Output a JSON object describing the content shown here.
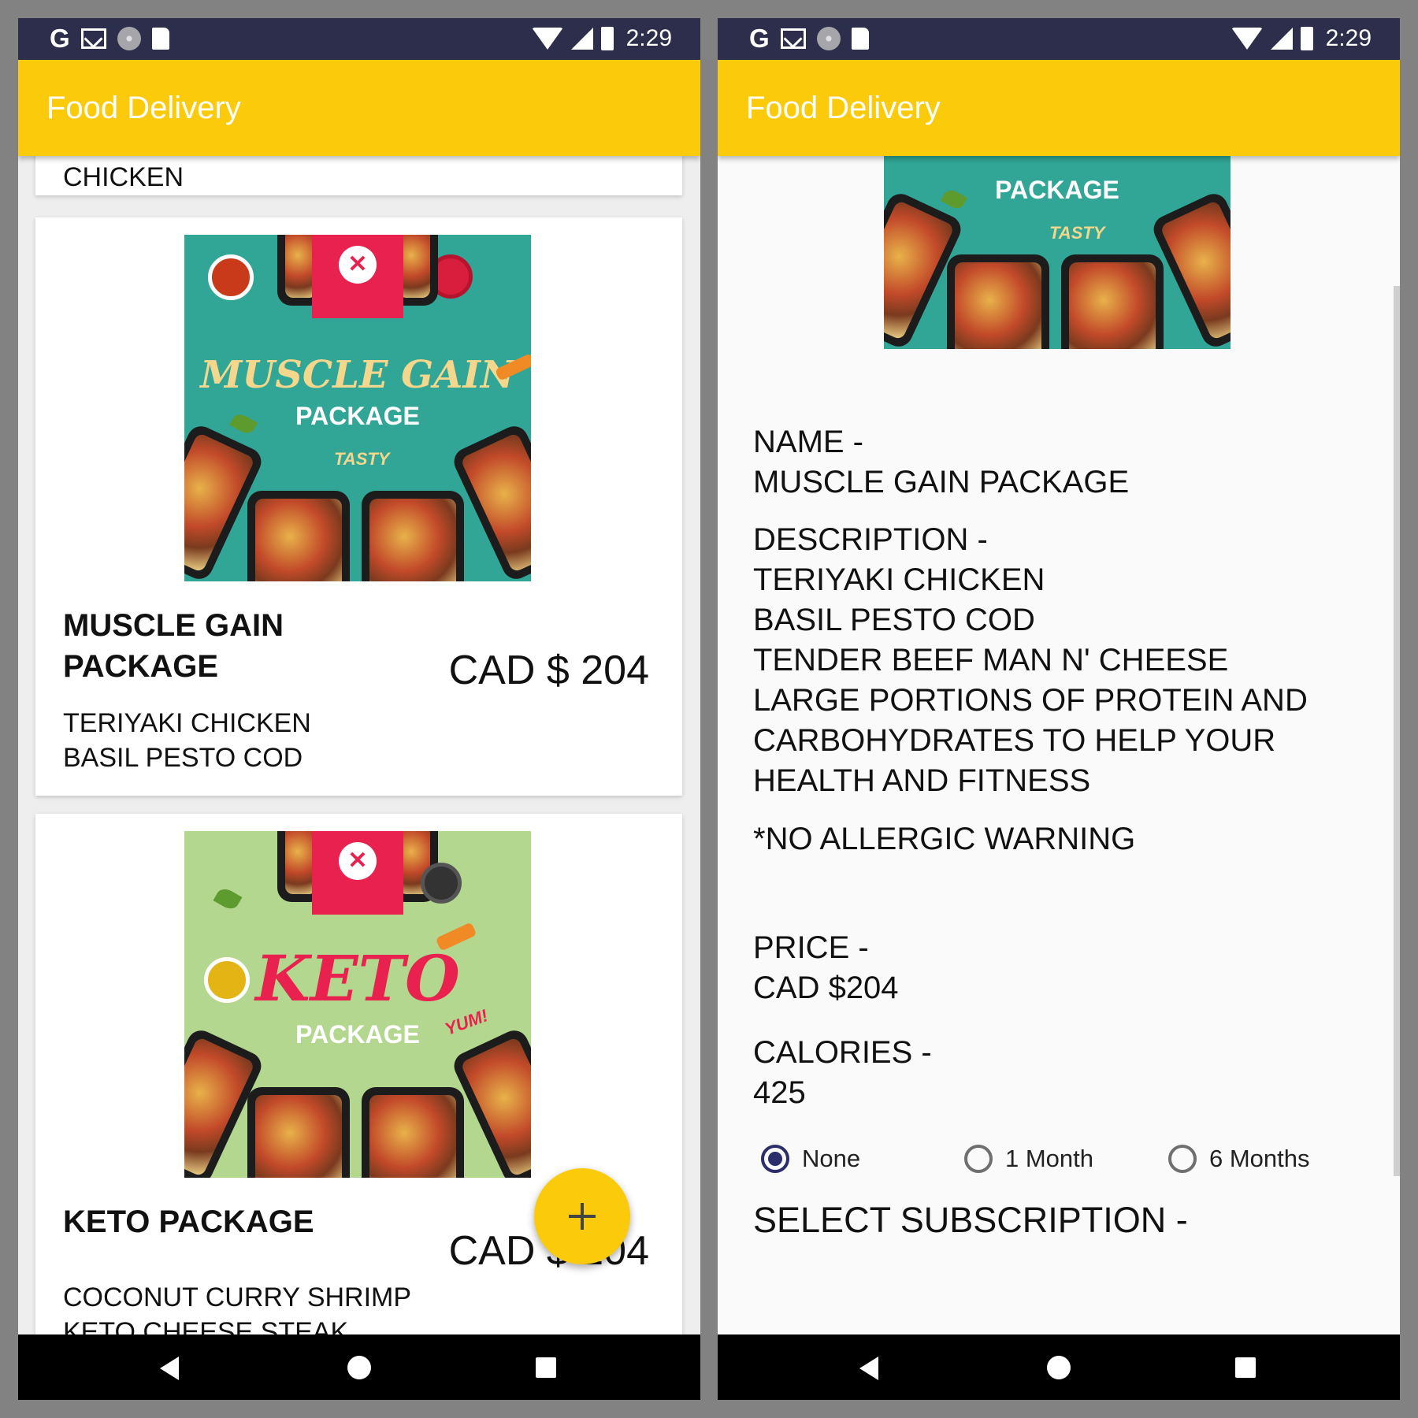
{
  "status_bar": {
    "time": "2:29"
  },
  "app": {
    "title": "Food Delivery"
  },
  "left_screen": {
    "partial_card_text": "CHICKEN",
    "cards": [
      {
        "image": {
          "title": "MUSCLE GAIN",
          "subtitle": "PACKAGE",
          "tag": "TASTY"
        },
        "name": "MUSCLE GAIN PACKAGE",
        "price": "CAD $ 204",
        "desc_line1": "TERIYAKI CHICKEN",
        "desc_line2": "BASIL PESTO COD"
      },
      {
        "image": {
          "title": "KETO",
          "subtitle": "PACKAGE",
          "tag": "YUM!"
        },
        "name": "KETO PACKAGE",
        "price": "CAD $ 204",
        "desc_line1": "COCONUT CURRY SHRIMP",
        "desc_line2": "KETO CHEESE STEAK"
      }
    ],
    "fab_icon": "add-icon"
  },
  "right_screen": {
    "image": {
      "subtitle": "PACKAGE",
      "tag": "TASTY"
    },
    "name_label": "NAME -",
    "name_value": "MUSCLE GAIN PACKAGE",
    "description_label": "DESCRIPTION -",
    "description_lines": [
      "TERIYAKI CHICKEN",
      "BASIL PESTO COD",
      "TENDER BEEF MAN N' CHEESE",
      "LARGE PORTIONS OF PROTEIN AND",
      "CARBOHYDRATES TO HELP YOUR",
      "HEALTH AND FITNESS"
    ],
    "allergy_warning": "*NO ALLERGIC WARNING",
    "price_label": "PRICE -",
    "price_value": "CAD $204",
    "calories_label": "CALORIES -",
    "calories_value": "425",
    "subscription_label": "SELECT SUBSCRIPTION -",
    "subscription_options": [
      "None",
      "1 Month",
      "6 Months"
    ],
    "subscription_selected": "None"
  },
  "colors": {
    "accent": "#fbcb0b",
    "status_bar": "#2c2e4c",
    "radio_selected": "#2c2e6c"
  }
}
